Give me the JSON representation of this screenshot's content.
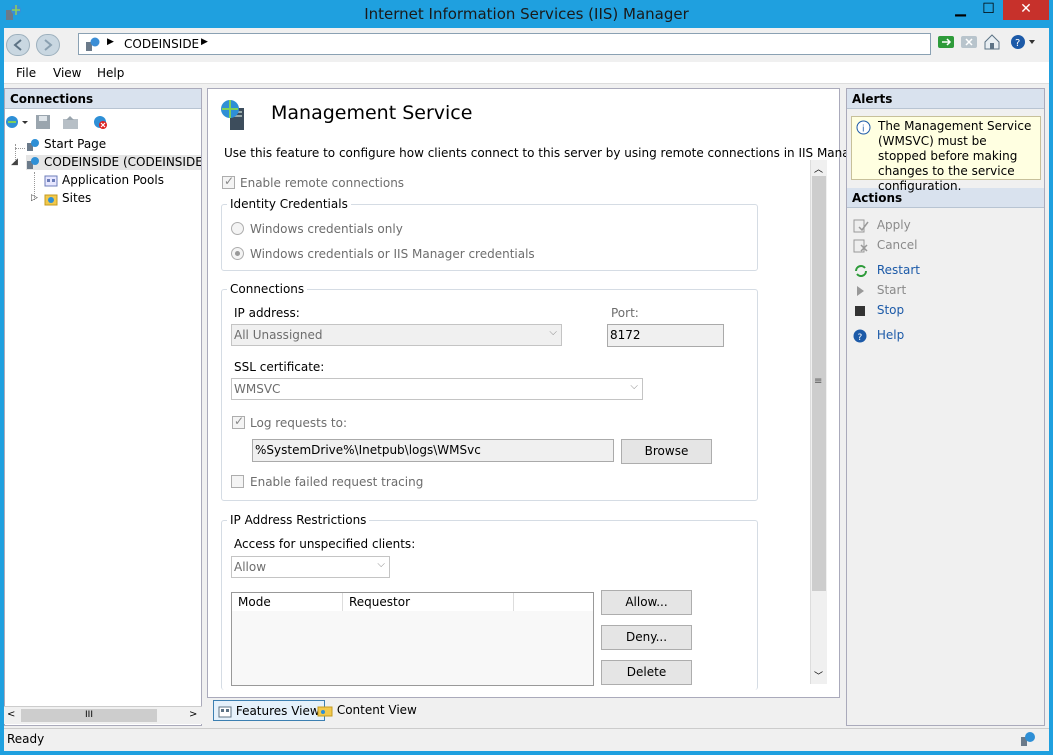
{
  "window": {
    "title": "Internet Information Services (IIS) Manager"
  },
  "address": {
    "breadcrumb": "CODEINSIDE"
  },
  "menu": [
    "File",
    "View",
    "Help"
  ],
  "connections": {
    "header": "Connections",
    "tree": [
      {
        "label": "Start Page",
        "icon": "start-page-icon"
      },
      {
        "label": "CODEINSIDE (CODEINSIDE\\co",
        "icon": "server-icon"
      },
      {
        "label": "Application Pools",
        "icon": "app-pools-icon"
      },
      {
        "label": "Sites",
        "icon": "sites-icon"
      }
    ],
    "hscroll_grip": "III"
  },
  "main": {
    "title": "Management Service",
    "description": "Use this feature to configure how clients connect to this server by using remote connections in IIS Manager.",
    "enable_remote": "Enable remote connections",
    "identity": {
      "label": "Identity Credentials",
      "opt1": "Windows credentials only",
      "opt2": "Windows credentials or IIS Manager credentials"
    },
    "connections": {
      "label": "Connections",
      "ip_label": "IP address:",
      "ip_value": "All Unassigned",
      "port_label": "Port:",
      "port_value": "8172",
      "ssl_label": "SSL certificate:",
      "ssl_value": "WMSVC",
      "log_label": "Log requests to:",
      "log_path": "%SystemDrive%\\Inetpub\\logs\\WMSvc",
      "browse": "Browse",
      "failed_tracing": "Enable failed request tracing"
    },
    "ip_restrictions": {
      "label": "IP Address Restrictions",
      "access_label": "Access for unspecified clients:",
      "access_value": "Allow",
      "col_mode": "Mode",
      "col_requestor": "Requestor",
      "allow_btn": "Allow...",
      "deny_btn": "Deny...",
      "delete_btn": "Delete"
    }
  },
  "views": {
    "features": "Features View",
    "content": "Content View"
  },
  "alerts": {
    "header": "Alerts",
    "message": "The Management Service (WMSVC) must be stopped before making changes to the service configuration."
  },
  "actions": {
    "header": "Actions",
    "apply": "Apply",
    "cancel": "Cancel",
    "restart": "Restart",
    "start": "Start",
    "stop": "Stop",
    "help": "Help"
  },
  "status": {
    "text": "Ready"
  }
}
